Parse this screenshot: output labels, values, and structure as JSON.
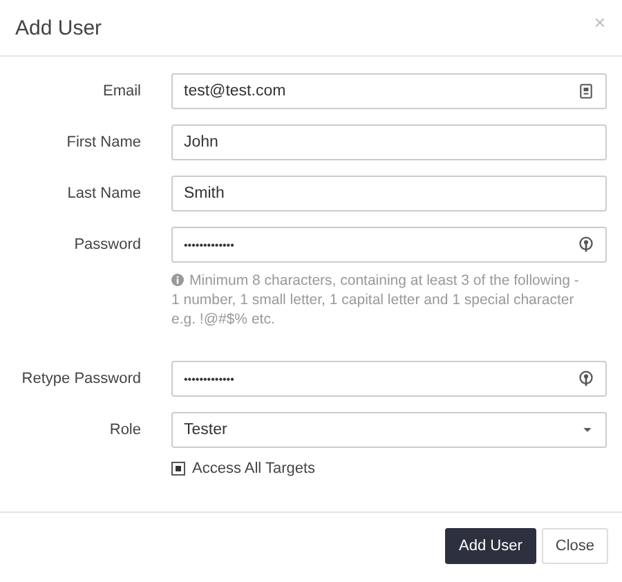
{
  "dialog": {
    "title": "Add User",
    "close": "×"
  },
  "fields": [
    {
      "label": "Email",
      "kind": "email",
      "value": "test@test.com"
    },
    {
      "label": "First Name",
      "kind": "text",
      "value": "John"
    },
    {
      "label": "Last Name",
      "kind": "text",
      "value": "Smith"
    },
    {
      "label": "Password",
      "kind": "password",
      "value": "•••••••••••••",
      "help": "Minimum 8 characters, containing at least 3 of the following - 1 number, 1 small letter, 1 capital letter and 1 special character e.g. !@#$% etc."
    },
    {
      "label": "Retype Password",
      "kind": "password",
      "value": "•••••••••••••"
    },
    {
      "label": "Role",
      "kind": "select",
      "value": "Tester"
    }
  ],
  "access_all_targets": {
    "label": "Access All Targets",
    "checked": true
  },
  "buttons": [
    {
      "label": "Add User",
      "kind": "primary"
    },
    {
      "label": "Close",
      "kind": "default"
    }
  ]
}
